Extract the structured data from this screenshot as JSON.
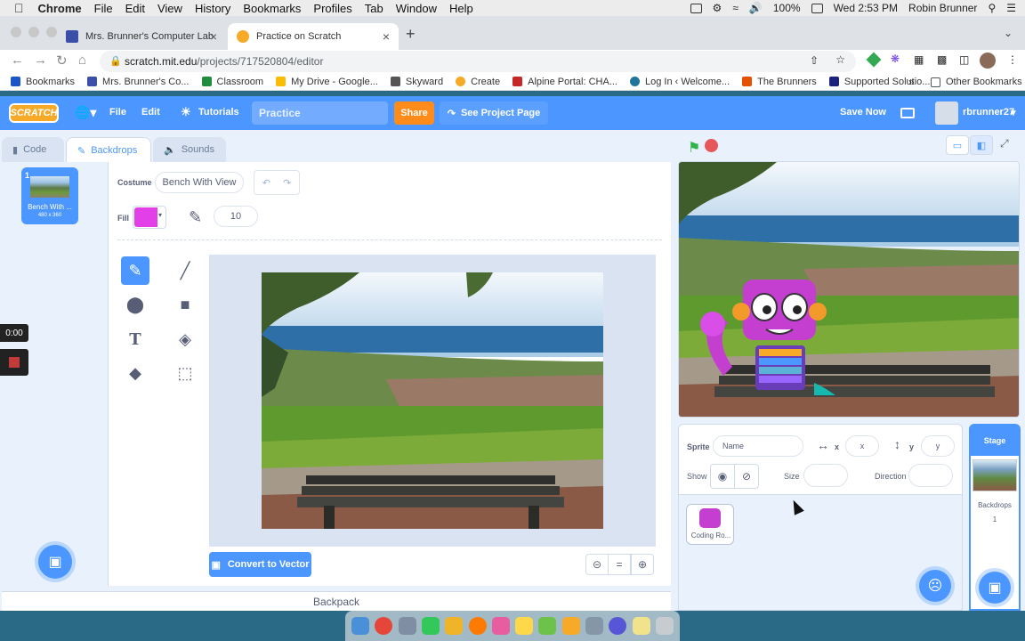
{
  "menubar": {
    "app": "Chrome",
    "items": [
      "File",
      "Edit",
      "View",
      "History",
      "Bookmarks",
      "Profiles",
      "Tab",
      "Window",
      "Help"
    ],
    "battery": "100%",
    "clock": "Wed 2:53 PM",
    "user": "Robin Brunner"
  },
  "tabs": [
    {
      "title": "Mrs. Brunner's Computer Lab",
      "active": false
    },
    {
      "title": "Practice on Scratch",
      "active": true
    }
  ],
  "address": {
    "domain": "scratch.mit.edu",
    "path": "/projects/717520804/editor"
  },
  "bookmarks": {
    "items": [
      "Bookmarks",
      "Mrs. Brunner's Co...",
      "Classroom",
      "My Drive - Google...",
      "Skyward",
      "Create",
      "Alpine Portal: CHA...",
      "Log In ‹ Welcome...",
      "The Brunners",
      "Supported Solutio..."
    ],
    "more": "»",
    "other": "Other Bookmarks"
  },
  "scratch": {
    "logo": "SCRATCH",
    "file": "File",
    "edit": "Edit",
    "tutorials": "Tutorials",
    "project_title": "Practice",
    "share": "Share",
    "see_project": "See Project Page",
    "save_now": "Save Now",
    "username": "rbrunner27"
  },
  "editor_tabs": {
    "code": "Code",
    "backdrops": "Backdrops",
    "sounds": "Sounds"
  },
  "costume_list": {
    "number": "1",
    "name": "Bench With ...",
    "size": "480 x 360"
  },
  "recording": {
    "timer": "0:00"
  },
  "paint": {
    "costume_label": "Costume",
    "costume_name": "Bench With View",
    "fill_label": "Fill",
    "fill_color": "#e23fe8",
    "brush_size": "10",
    "convert": "Convert to Vector",
    "zoom_reset": "="
  },
  "backpack": "Backpack",
  "sprite_info": {
    "sprite_label": "Sprite",
    "name_placeholder": "Name",
    "x_label": "x",
    "x_placeholder": "x",
    "y_label": "y",
    "y_placeholder": "y",
    "show_label": "Show",
    "size_label": "Size",
    "direction_label": "Direction"
  },
  "sprites": [
    {
      "name": "Coding Ro..."
    }
  ],
  "stage_pane": {
    "label": "Stage",
    "backdrops_label": "Backdrops",
    "backdrops_count": "1"
  },
  "colors": {
    "scratch_blue": "#4c97ff",
    "share_orange": "#ff8c1a",
    "flag_green": "#2fb347",
    "stop_red": "#e6575a"
  }
}
